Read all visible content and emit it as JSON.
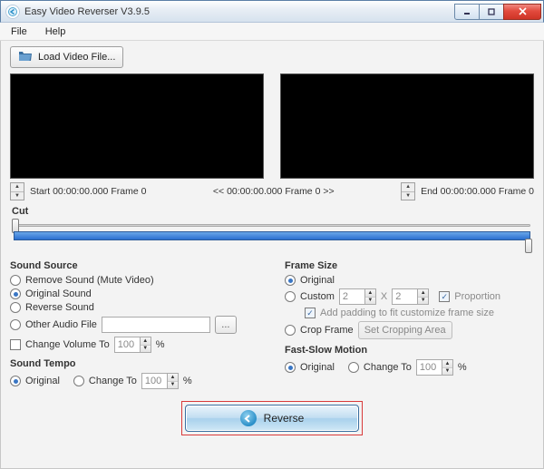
{
  "window": {
    "title": "Easy Video Reverser V3.9.5"
  },
  "menu": {
    "file": "File",
    "help": "Help"
  },
  "toolbar": {
    "load_label": "Load Video File..."
  },
  "timeline": {
    "start_label": "Start 00:00:00.000 Frame 0",
    "mid_label": "<< 00:00:00.000  Frame 0 >>",
    "end_label": "End 00:00:00.000  Frame 0"
  },
  "cut": {
    "label": "Cut"
  },
  "sound_source": {
    "title": "Sound Source",
    "remove": "Remove Sound (Mute Video)",
    "original": "Original Sound",
    "reverse": "Reverse Sound",
    "other": "Other Audio File",
    "browse": "...",
    "change_volume": "Change Volume To",
    "volume_value": "100",
    "percent": "%"
  },
  "sound_tempo": {
    "title": "Sound Tempo",
    "original": "Original",
    "change_to": "Change To",
    "value": "100",
    "percent": "%"
  },
  "frame_size": {
    "title": "Frame Size",
    "original": "Original",
    "custom": "Custom",
    "w": "2",
    "x": "X",
    "h": "2",
    "proportion": "Proportion",
    "padding": "Add padding to fit customize frame size",
    "crop": "Crop Frame",
    "set_crop": "Set Cropping Area"
  },
  "motion": {
    "title": "Fast-Slow Motion",
    "original": "Original",
    "change_to": "Change To",
    "value": "100",
    "percent": "%"
  },
  "action": {
    "reverse": "Reverse"
  }
}
